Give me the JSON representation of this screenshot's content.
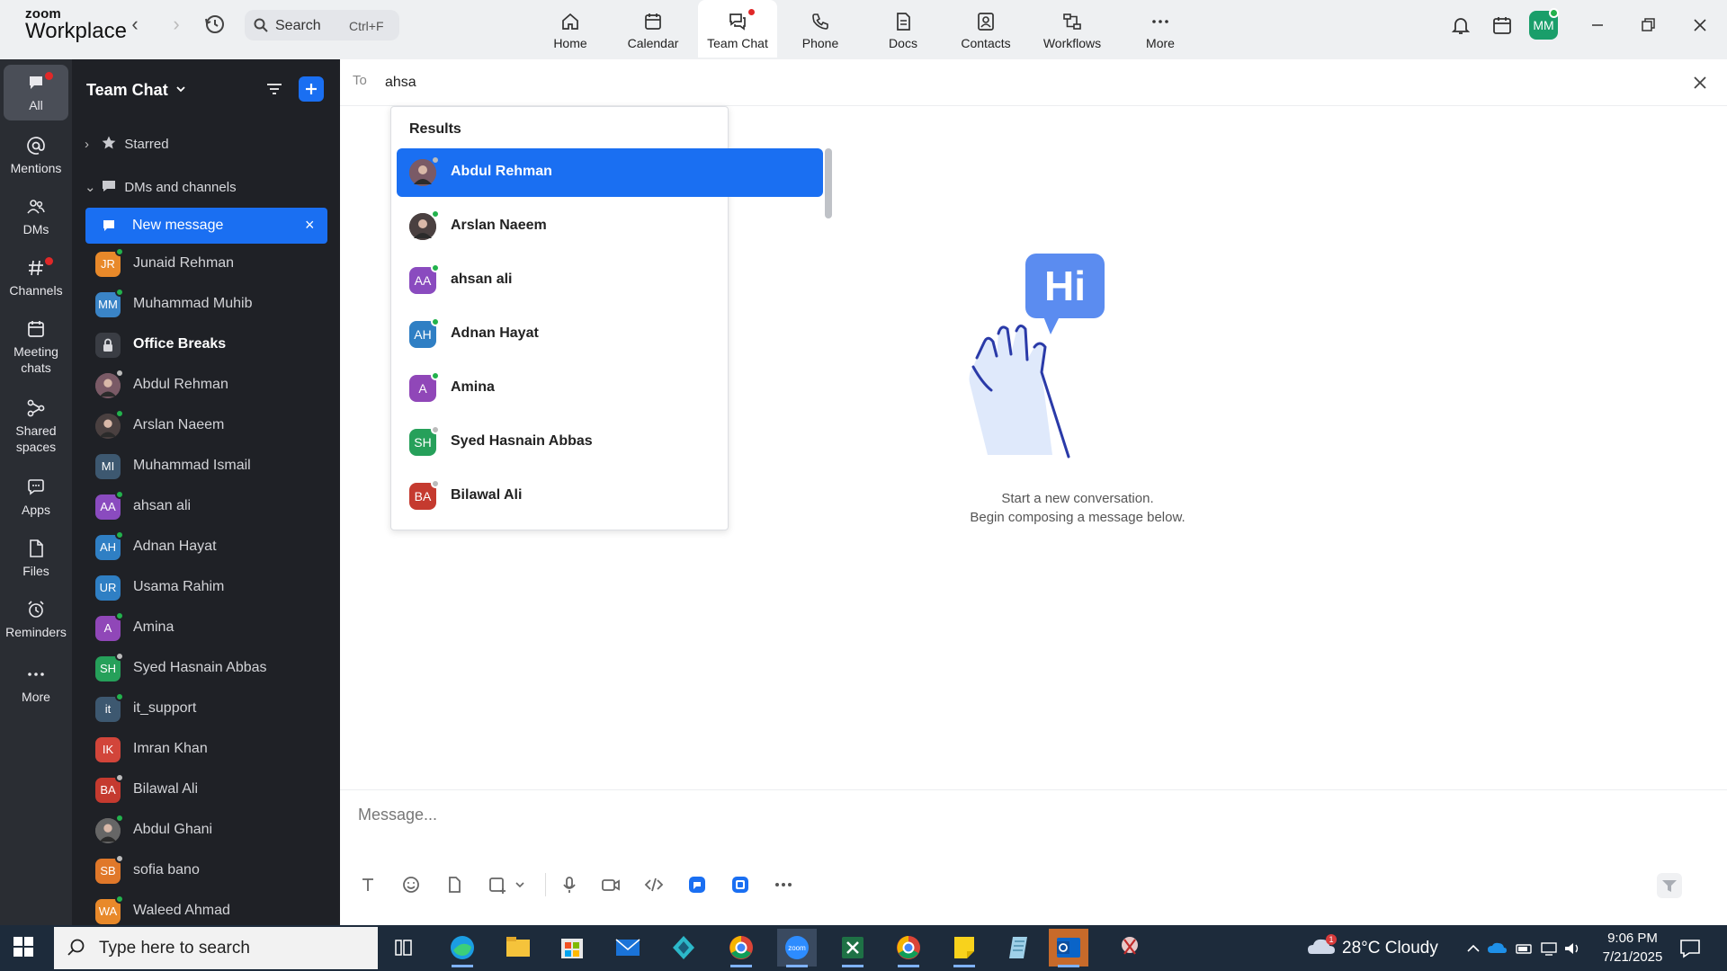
{
  "app": {
    "logo_line1": "zoom",
    "logo_line2": "Workplace"
  },
  "top_search": {
    "label": "Search",
    "shortcut": "Ctrl+F"
  },
  "tabs": [
    {
      "label": "Home",
      "icon": "home-icon",
      "active": false
    },
    {
      "label": "Calendar",
      "icon": "calendar-icon",
      "active": false
    },
    {
      "label": "Team Chat",
      "icon": "chat-icon",
      "active": true,
      "badge": true
    },
    {
      "label": "Phone",
      "icon": "phone-icon",
      "active": false
    },
    {
      "label": "Docs",
      "icon": "docs-icon",
      "active": false
    },
    {
      "label": "Contacts",
      "icon": "contacts-icon",
      "active": false
    },
    {
      "label": "Workflows",
      "icon": "workflows-icon",
      "active": false
    },
    {
      "label": "More",
      "icon": "more-icon",
      "active": false
    }
  ],
  "user": {
    "initials": "MM",
    "status": "available"
  },
  "left_nav": [
    {
      "label": "All",
      "icon": "chat-bubble-icon",
      "active": true,
      "badge": true
    },
    {
      "label": "Mentions",
      "icon": "at-icon",
      "active": false
    },
    {
      "label": "DMs",
      "icon": "people-icon",
      "active": false
    },
    {
      "label": "Channels",
      "icon": "hash-icon",
      "active": false,
      "badge": true
    },
    {
      "label": "Meeting\nchats",
      "icon": "calendar-icon",
      "active": false
    },
    {
      "label": "Shared\nspaces",
      "icon": "share-icon",
      "active": false
    },
    {
      "label": "Apps",
      "icon": "apps-icon",
      "active": false
    },
    {
      "label": "Files",
      "icon": "file-icon",
      "active": false
    },
    {
      "label": "Reminders",
      "icon": "alarm-icon",
      "active": false
    },
    {
      "label": "More",
      "icon": "more-icon",
      "active": false
    }
  ],
  "sidebar": {
    "title": "Team Chat",
    "starred_label": "Starred",
    "dms_label": "DMs and channels",
    "new_message_label": "New message",
    "items": [
      {
        "name": "Junaid Rehman",
        "initials": "JR",
        "color": "#e8892a",
        "status": "#22b24c",
        "bold": false
      },
      {
        "name": "Muhammad Muhib",
        "initials": "MM",
        "color": "#3a84c6",
        "status": "#22b24c",
        "bold": false
      },
      {
        "name": "Office Breaks",
        "initials": "",
        "color": "#3a3d44",
        "status": "",
        "bold": true,
        "lock": true
      },
      {
        "name": "Abdul Rehman",
        "initials": "",
        "color": "#7a5a66",
        "status": "#bbbbbb",
        "bold": false,
        "photo": true
      },
      {
        "name": "Arslan Naeem",
        "initials": "",
        "color": "#4a4040",
        "status": "#22b24c",
        "bold": false,
        "photo": true
      },
      {
        "name": "Muhammad Ismail",
        "initials": "MI",
        "color": "#3d5870",
        "status": "",
        "bold": false
      },
      {
        "name": "ahsan ali",
        "initials": "AA",
        "color": "#8a4bbf",
        "status": "#22b24c",
        "bold": false
      },
      {
        "name": "Adnan Hayat",
        "initials": "AH",
        "color": "#2f7fc4",
        "status": "#22b24c",
        "bold": false
      },
      {
        "name": "Usama Rahim",
        "initials": "UR",
        "color": "#2f7fc4",
        "status": "",
        "bold": false
      },
      {
        "name": "Amina",
        "initials": "A",
        "color": "#9047b8",
        "status": "#22b24c",
        "bold": false
      },
      {
        "name": "Syed Hasnain Abbas",
        "initials": "SH",
        "color": "#26a05a",
        "status": "#bbbbbb",
        "bold": false
      },
      {
        "name": "it_support",
        "initials": "it",
        "color": "#3d5870",
        "status": "#22b24c",
        "bold": false
      },
      {
        "name": "Imran Khan",
        "initials": "IK",
        "color": "#d2453a",
        "status": "",
        "bold": false
      },
      {
        "name": "Bilawal Ali",
        "initials": "BA",
        "color": "#c53a2f",
        "status": "#bbbbbb",
        "bold": false
      },
      {
        "name": "Abdul Ghani",
        "initials": "",
        "color": "#666666",
        "status": "#22b24c",
        "bold": false,
        "photo": true
      },
      {
        "name": "sofia bano",
        "initials": "SB",
        "color": "#e0782a",
        "status": "#bbbbbb",
        "bold": false
      },
      {
        "name": "Waleed Ahmad",
        "initials": "WA",
        "color": "#e8892a",
        "status": "#22b24c",
        "bold": false
      }
    ]
  },
  "compose": {
    "to_label": "To",
    "to_value": "ahsa",
    "results_header": "Results",
    "results": [
      {
        "name": "Abdul Rehman",
        "initials": "",
        "color": "#7a5a66",
        "status": "#bbbbbb",
        "photo": true,
        "selected": true
      },
      {
        "name": "Arslan Naeem",
        "initials": "",
        "color": "#4a4040",
        "status": "#22b24c",
        "photo": true,
        "selected": false
      },
      {
        "name": "ahsan ali",
        "initials": "AA",
        "color": "#8a4bbf",
        "status": "#22b24c",
        "selected": false
      },
      {
        "name": "Adnan Hayat",
        "initials": "AH",
        "color": "#2f7fc4",
        "status": "#22b24c",
        "selected": false
      },
      {
        "name": "Amina",
        "initials": "A",
        "color": "#9047b8",
        "status": "#22b24c",
        "selected": false
      },
      {
        "name": "Syed Hasnain Abbas",
        "initials": "SH",
        "color": "#26a05a",
        "status": "#bbbbbb",
        "selected": false
      },
      {
        "name": "Bilawal Ali",
        "initials": "BA",
        "color": "#c53a2f",
        "status": "#bbbbbb",
        "selected": false
      }
    ],
    "empty_line1": "Start a new conversation.",
    "empty_line2": "Begin composing a message below.",
    "illustration_text": "Hi",
    "message_placeholder": "Message..."
  },
  "taskbar": {
    "search_placeholder": "Type here to search",
    "weather": "28°C  Cloudy",
    "weather_badge": "1",
    "time": "9:06 PM",
    "date": "7/21/2025"
  }
}
